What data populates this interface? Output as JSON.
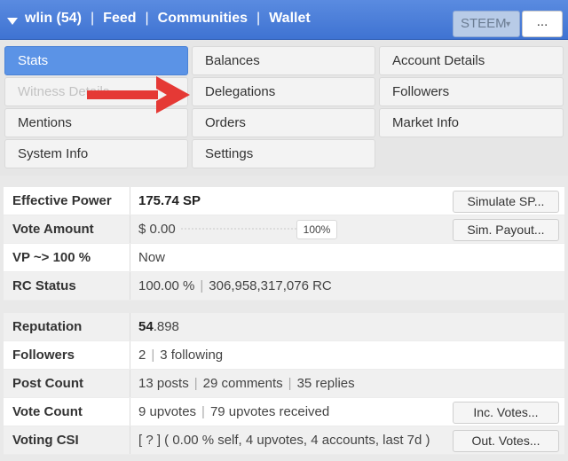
{
  "header": {
    "user": "wlin (54)",
    "sep": "|",
    "links": [
      "Feed",
      "Communities",
      "Wallet"
    ],
    "currency": "STEEM",
    "currency_arrow": "▼",
    "more": "..."
  },
  "tabs": {
    "stats": "Stats",
    "balances": "Balances",
    "account_details": "Account Details",
    "witness_details": "Witness Details",
    "delegations": "Delegations",
    "followers": "Followers",
    "mentions": "Mentions",
    "orders": "Orders",
    "market_info": "Market Info",
    "system_info": "System Info",
    "settings": "Settings"
  },
  "stats": {
    "effective_power": {
      "label": "Effective Power",
      "value": "175.74 SP",
      "button": "Simulate SP..."
    },
    "vote_amount": {
      "label": "Vote Amount",
      "value": "$ 0.00",
      "percent": "100%",
      "button": "Sim. Payout..."
    },
    "vp": {
      "label": "VP ~> 100 %",
      "value": "Now"
    },
    "rc_status": {
      "label": "RC Status",
      "value_a": "100.00 %",
      "value_b": "306,958,317,076 RC"
    },
    "reputation": {
      "label": "Reputation",
      "value_int": "54",
      "value_dec": ".898"
    },
    "followers": {
      "label": "Followers",
      "value_a": "2",
      "value_b": "3 following"
    },
    "post_count": {
      "label": "Post Count",
      "value_a": "13 posts",
      "value_b": "29 comments",
      "value_c": "35 replies"
    },
    "vote_count": {
      "label": "Vote Count",
      "value_a": "9 upvotes",
      "value_b": "79 upvotes received",
      "button": "Inc. Votes..."
    },
    "voting_csi": {
      "label": "Voting CSI",
      "value": "[ ? ] ( 0.00 % self, 4 upvotes, 4 accounts, last 7d )",
      "button": "Out. Votes..."
    }
  },
  "pipe": "|",
  "colors": {
    "header_blue": "#4a7fda",
    "active_tab": "#5b93e6",
    "arrow_red": "#e53935"
  }
}
